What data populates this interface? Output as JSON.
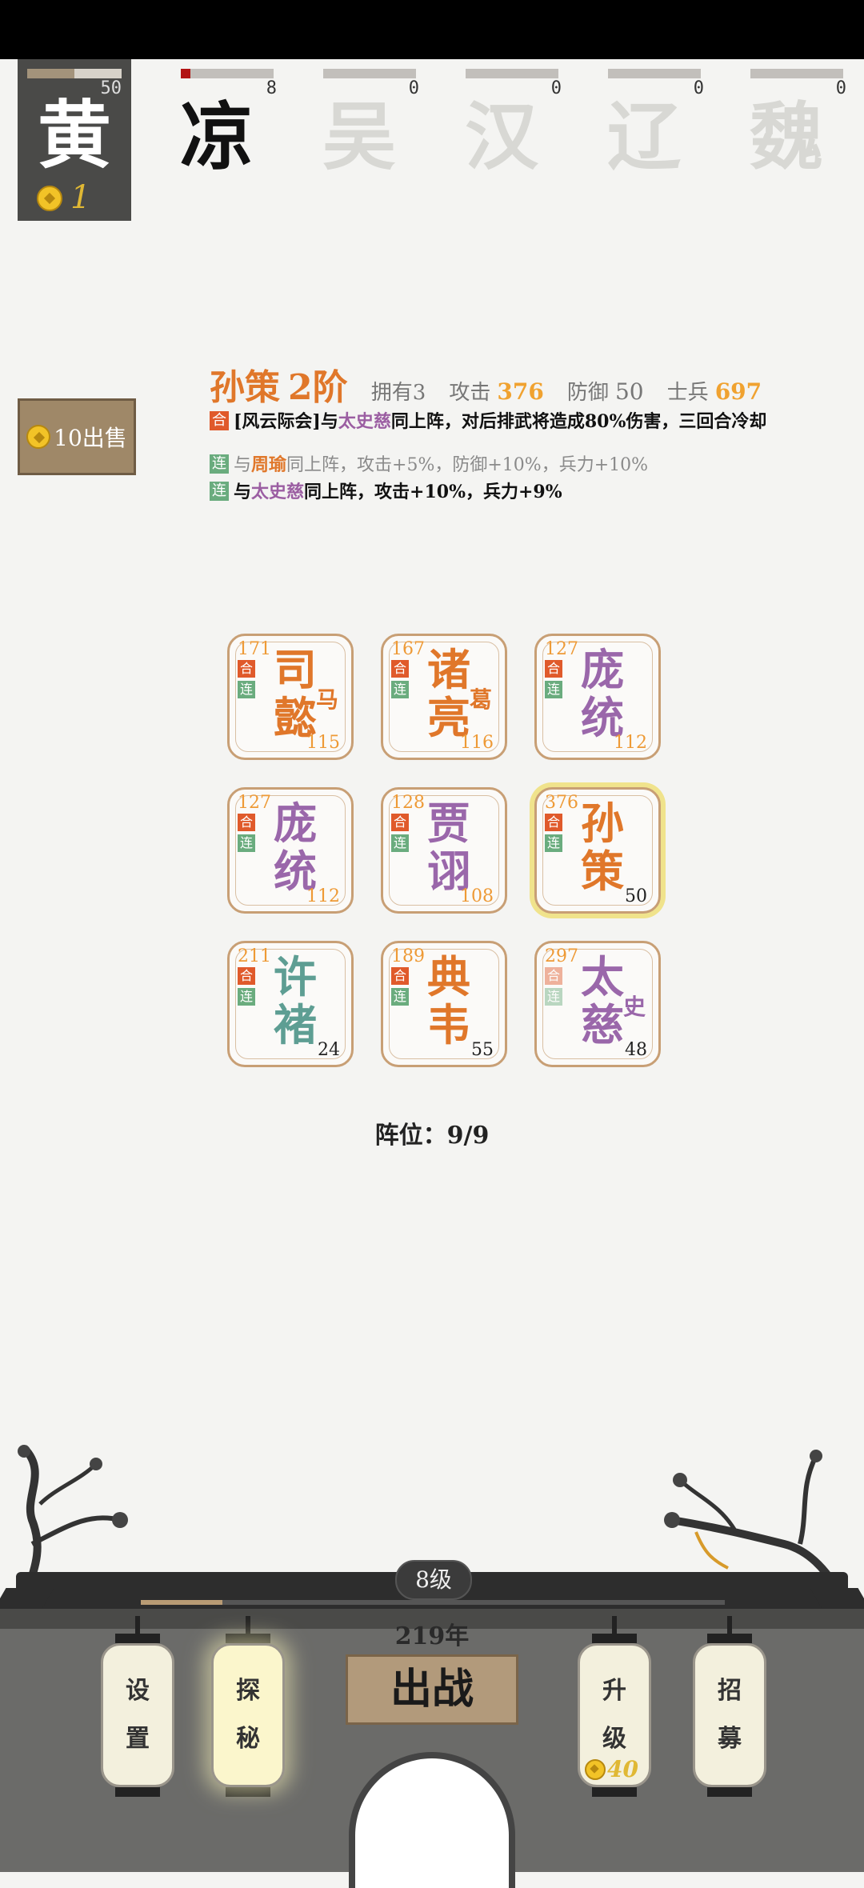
{
  "factions": [
    {
      "id": "huang",
      "name": "黄",
      "count": "50",
      "progress": 0.5,
      "selected": true,
      "coins": "1"
    },
    {
      "id": "liang",
      "name": "凉",
      "count": "8",
      "progress": 0.1,
      "active": true
    },
    {
      "id": "wu",
      "name": "吴",
      "count": "0",
      "progress": 0
    },
    {
      "id": "han",
      "name": "汉",
      "count": "0",
      "progress": 0
    },
    {
      "id": "liao",
      "name": "辽",
      "count": "0",
      "progress": 0
    },
    {
      "id": "wei",
      "name": "魏",
      "count": "0",
      "progress": 0
    }
  ],
  "sell": {
    "label": "10出售"
  },
  "hero": {
    "name": "孙策",
    "tier": "2阶",
    "owned_label": "拥有3",
    "atk_label": "攻击",
    "atk": "376",
    "def_label": "防御",
    "def": "50",
    "troops_label": "士兵",
    "troops": "697"
  },
  "skills": [
    {
      "tag": "合",
      "parts": [
        "[风云际会]与",
        "太史慈",
        "同上阵，对后排武将造成80%伤害，三回合冷却"
      ]
    },
    {
      "tag": "连",
      "parts": [
        "与",
        "周瑜",
        "同上阵，攻击+5%，防御+10%，兵力+10%"
      ]
    },
    {
      "tag": "连",
      "parts": [
        "与",
        "太史慈",
        "同上阵，攻击+10%，兵力+9%"
      ]
    }
  ],
  "tags": {
    "he": "合",
    "lian": "连"
  },
  "grid": [
    {
      "atk": "171",
      "c1": "司",
      "c2": "懿",
      "small": "马",
      "num": "115",
      "color": "orange",
      "numColor": "orange"
    },
    {
      "atk": "167",
      "c1": "诸",
      "c2": "亮",
      "small": "葛",
      "num": "116",
      "color": "orange",
      "numColor": "orange"
    },
    {
      "atk": "127",
      "c1": "庞",
      "c2": "统",
      "small": "",
      "num": "112",
      "color": "purple",
      "numColor": "orange"
    },
    {
      "atk": "127",
      "c1": "庞",
      "c2": "统",
      "small": "",
      "num": "112",
      "color": "purple",
      "numColor": "orange"
    },
    {
      "atk": "128",
      "c1": "贾",
      "c2": "诩",
      "small": "",
      "num": "108",
      "color": "purple",
      "numColor": "orange"
    },
    {
      "atk": "376",
      "c1": "孙",
      "c2": "策",
      "small": "",
      "num": "50",
      "color": "orange",
      "numColor": "dark",
      "selected": true
    },
    {
      "atk": "211",
      "c1": "许",
      "c2": "褚",
      "small": "",
      "num": "24",
      "color": "teal",
      "numColor": "dark"
    },
    {
      "atk": "189",
      "c1": "典",
      "c2": "韦",
      "small": "",
      "num": "55",
      "color": "orange",
      "numColor": "dark"
    },
    {
      "atk": "297",
      "c1": "太",
      "c2": "慈",
      "small": "史",
      "num": "48",
      "color": "purple",
      "numColor": "dark",
      "dimTags": true
    }
  ],
  "formation": "阵位：9/9",
  "level": {
    "label": "8级",
    "xp": 0.14
  },
  "year": "219年",
  "battle": {
    "label": "出战"
  },
  "lanterns": [
    {
      "id": "settings",
      "l1": "设",
      "l2": "置"
    },
    {
      "id": "explore",
      "l1": "探",
      "l2": "秘",
      "glow": true
    },
    {
      "id": "upgrade",
      "l1": "升",
      "l2": "级",
      "cost": "40"
    },
    {
      "id": "recruit",
      "l1": "招",
      "l2": "募"
    }
  ]
}
